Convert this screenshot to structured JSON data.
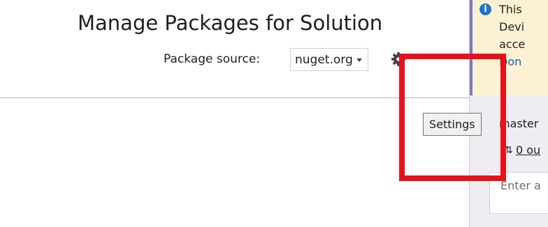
{
  "left_pane": {
    "title": "Manage Packages for Solution",
    "package_source_label": "Package source:",
    "package_source_value": "nuget.org",
    "settings_icon": "gear-icon"
  },
  "tooltip": {
    "text": "Settings"
  },
  "right_pane": {
    "info_icon": "info-icon",
    "info_lines": [
      "This",
      "Devi",
      "acce"
    ],
    "info_link": "Don",
    "branch": "master",
    "sync_icon": "⇅",
    "sync_text": "0 ou",
    "message_placeholder": "Enter a"
  },
  "colors": {
    "highlight": "#e8111b",
    "infobar_bg": "#fcf2d3",
    "infobar_accent": "#7a78c5",
    "info_icon": "#1e74c9",
    "link": "#1a5fb4",
    "panel_bg": "#eeeef2"
  }
}
